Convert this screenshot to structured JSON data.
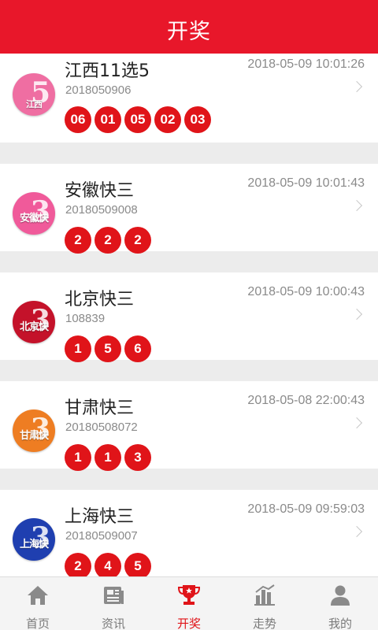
{
  "header": {
    "title": "开奖"
  },
  "lotteries": [
    {
      "name": "江西11选5",
      "issue": "2018050906",
      "time": "2018-05-09 10:01:26",
      "logo_text": "江西",
      "logo_big": "5",
      "logo_color": "#ef6ea2",
      "numbers": [
        "06",
        "01",
        "05",
        "02",
        "03"
      ]
    },
    {
      "name": "安徽快三",
      "issue": "20180509008",
      "time": "2018-05-09 10:01:43",
      "logo_text": "安徽快",
      "logo_big": "3",
      "logo_color": "#f05a9a",
      "numbers": [
        "2",
        "2",
        "2"
      ]
    },
    {
      "name": "北京快三",
      "issue": "108839",
      "time": "2018-05-09 10:00:43",
      "logo_text": "北京快",
      "logo_big": "3",
      "logo_color": "#c4122a",
      "numbers": [
        "1",
        "5",
        "6"
      ]
    },
    {
      "name": "甘肃快三",
      "issue": "20180508072",
      "time": "2018-05-08 22:00:43",
      "logo_text": "甘肃快",
      "logo_big": "3",
      "logo_color": "#ee7d22",
      "numbers": [
        "1",
        "1",
        "3"
      ]
    },
    {
      "name": "上海快三",
      "issue": "20180509007",
      "time": "2018-05-09 09:59:03",
      "logo_text": "上海快",
      "logo_big": "3",
      "logo_color": "#1f3fb0",
      "numbers": [
        "2",
        "4",
        "5"
      ]
    }
  ],
  "tabs": [
    {
      "label": "首页",
      "icon": "home-icon",
      "active": false
    },
    {
      "label": "资讯",
      "icon": "news-icon",
      "active": false
    },
    {
      "label": "开奖",
      "icon": "trophy-icon",
      "active": true
    },
    {
      "label": "走势",
      "icon": "chart-icon",
      "active": false
    },
    {
      "label": "我的",
      "icon": "user-icon",
      "active": false
    }
  ],
  "colors": {
    "brand": "#e8172a",
    "ball": "#e01419",
    "tab_inactive": "#7a7a7a"
  }
}
